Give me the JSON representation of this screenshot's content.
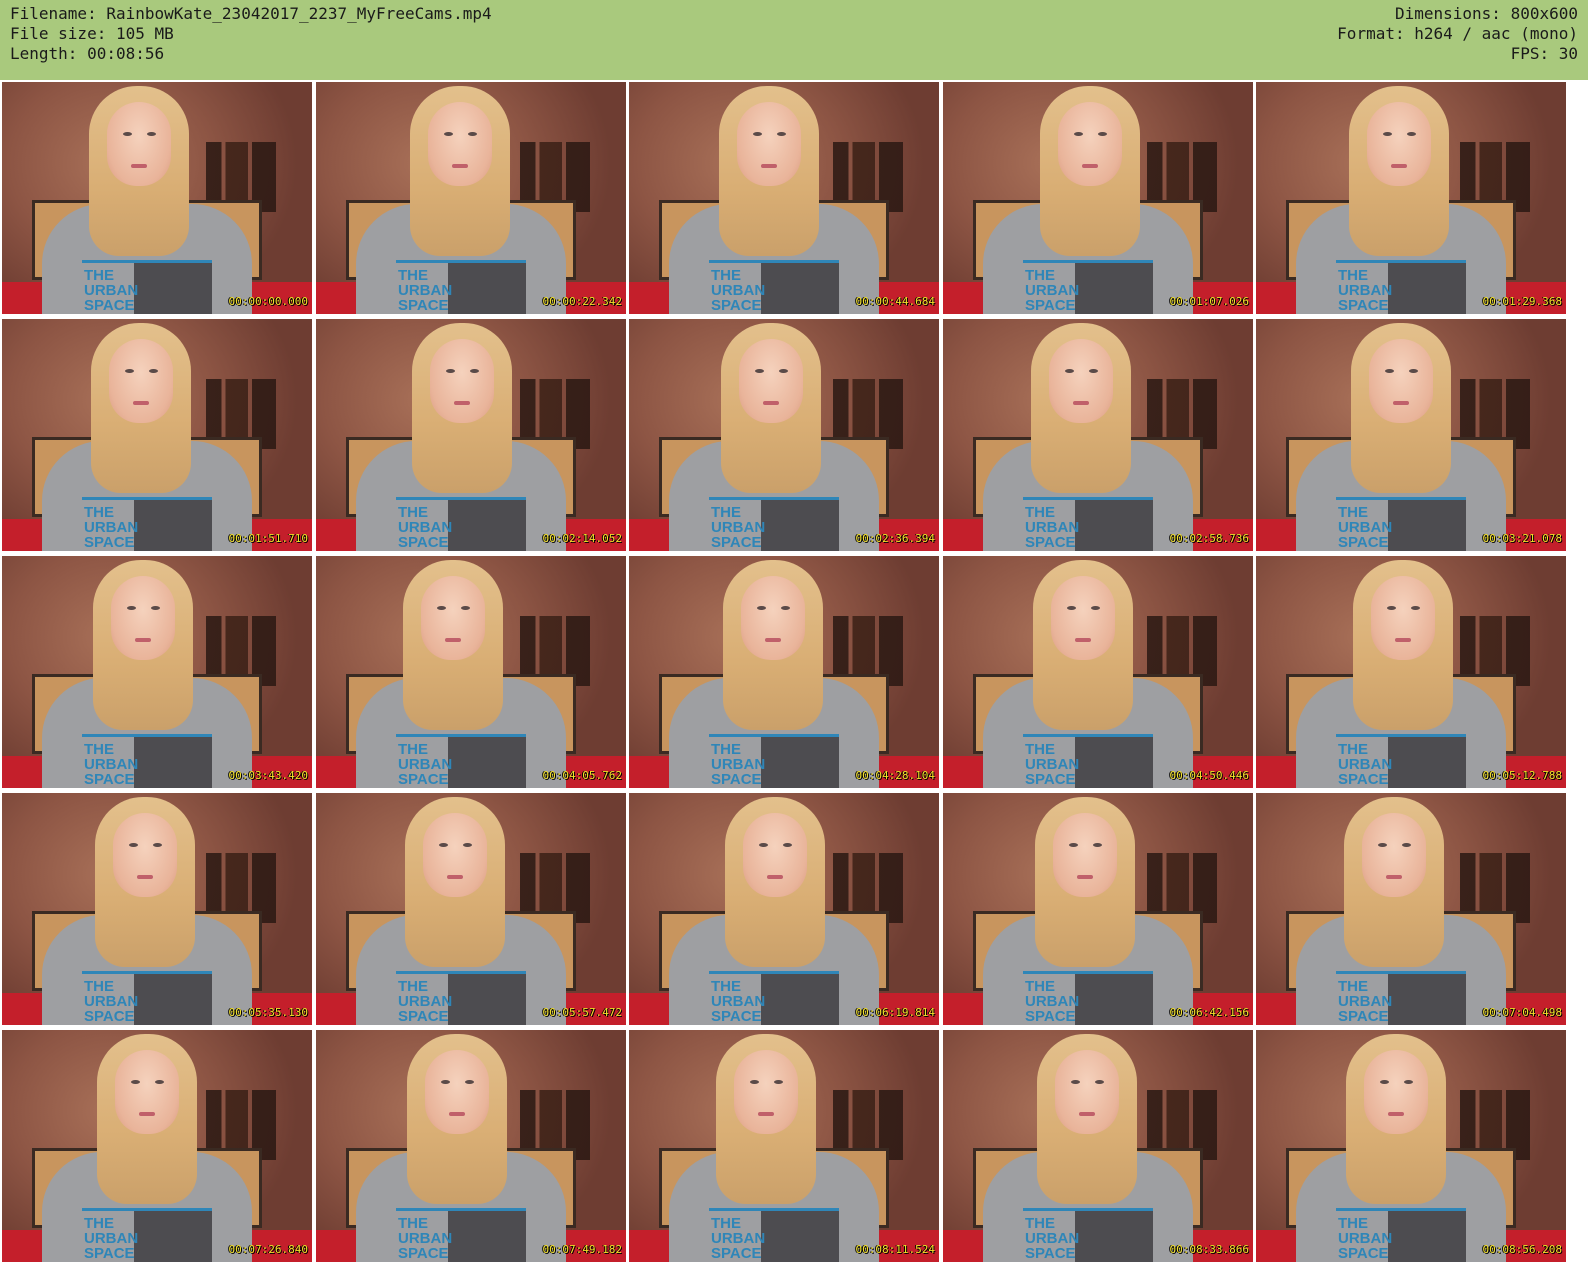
{
  "header": {
    "filename_line": "Filename: RainbowKate_23042017_2237_MyFreeCams.mp4",
    "filesize_line": "File size: 105 MB",
    "length_line": "Length: 00:08:56",
    "dimensions_line": "Dimensions: 800x600",
    "format_line": "Format: h264 / aac (mono)",
    "fps_line": "FPS: 30"
  },
  "colors": {
    "header_bg": "#a9c97d",
    "timestamp": "#f2e02a",
    "bed": "#c41f2b",
    "shirt": "#9e9fa2"
  },
  "shirt_print": [
    "THE",
    "URBAN",
    "SPACE"
  ],
  "thumbnails": [
    {
      "time": "00:00:00.000"
    },
    {
      "time": "00:00:22.342"
    },
    {
      "time": "00:00:44.684"
    },
    {
      "time": "00:01:07.026"
    },
    {
      "time": "00:01:29.368"
    },
    {
      "time": "00:01:51.710"
    },
    {
      "time": "00:02:14.052"
    },
    {
      "time": "00:02:36.394"
    },
    {
      "time": "00:02:58.736"
    },
    {
      "time": "00:03:21.078"
    },
    {
      "time": "00:03:43.420"
    },
    {
      "time": "00:04:05.762"
    },
    {
      "time": "00:04:28.104"
    },
    {
      "time": "00:04:50.446"
    },
    {
      "time": "00:05:12.788"
    },
    {
      "time": "00:05:35.130"
    },
    {
      "time": "00:05:57.472"
    },
    {
      "time": "00:06:19.814"
    },
    {
      "time": "00:06:42.156"
    },
    {
      "time": "00:07:04.498"
    },
    {
      "time": "00:07:26.840"
    },
    {
      "time": "00:07:49.182"
    },
    {
      "time": "00:08:11.524"
    },
    {
      "time": "00:08:33.866"
    },
    {
      "time": "00:08:56.208"
    }
  ]
}
